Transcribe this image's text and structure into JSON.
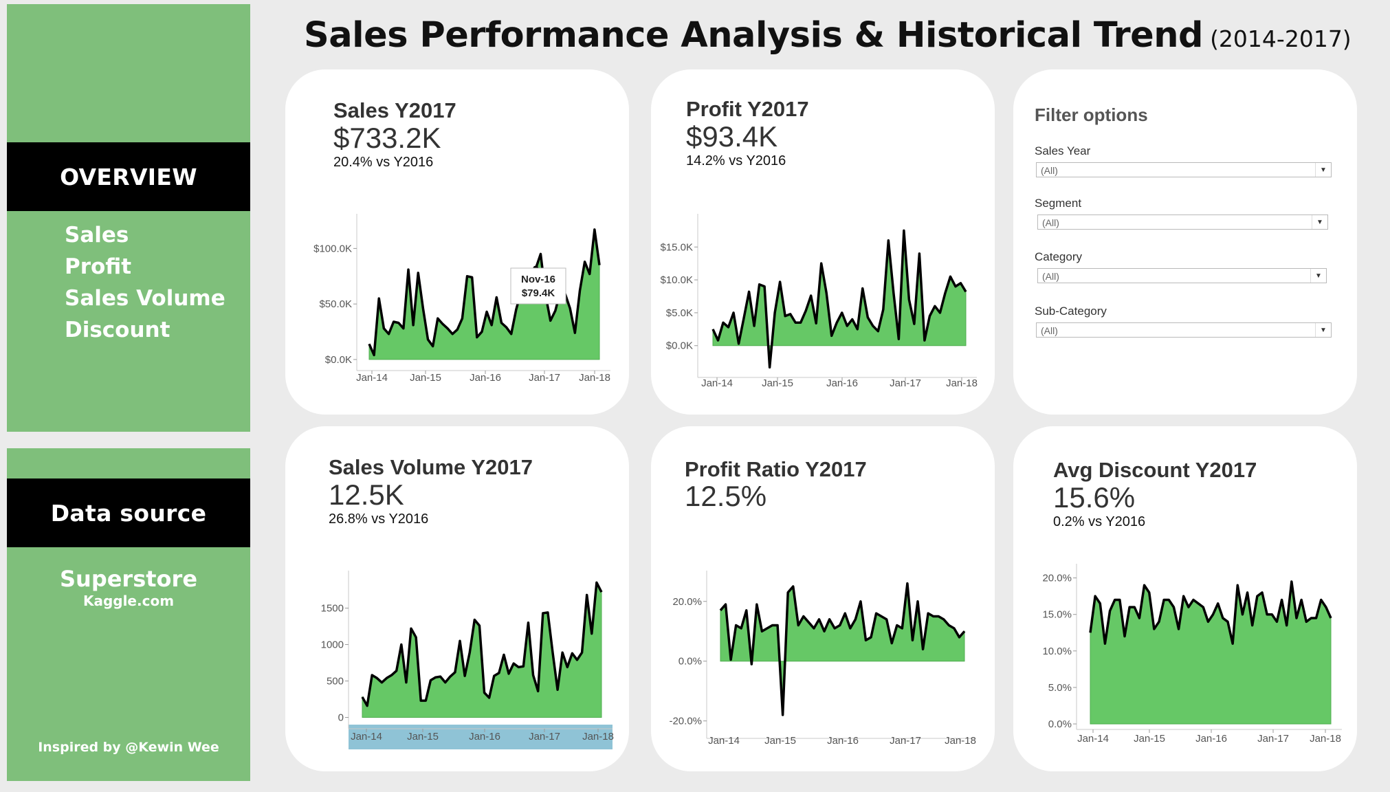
{
  "page": {
    "title": "Sales Performance Analysis & Historical Trend",
    "subtitle": "(2014-2017)"
  },
  "sidebar": {
    "overview_label": "OVERVIEW",
    "nav": [
      "Sales",
      "Profit",
      "Sales Volume",
      "Discount"
    ],
    "datasource_label": "Data source",
    "source_name": "Superstore",
    "source_site": "Kaggle.com",
    "credit": "Inspired by @Kewin Wee"
  },
  "cards": {
    "sales": {
      "title": "Sales Y2017",
      "value": "$733.2K",
      "delta": "20.4% vs Y2016"
    },
    "profit": {
      "title": "Profit Y2017",
      "value": "$93.4K",
      "delta": "14.2% vs Y2016"
    },
    "volume": {
      "title": "Sales Volume Y2017",
      "value": "12.5K",
      "delta": "26.8% vs Y2016"
    },
    "ratio": {
      "title": "Profit Ratio Y2017",
      "value": "12.5%"
    },
    "discount": {
      "title": "Avg Discount Y2017",
      "value": "15.6%",
      "delta": "0.2% vs Y2016"
    }
  },
  "filters": {
    "title": "Filter options",
    "items": [
      {
        "label": "Sales Year",
        "value": "(All)"
      },
      {
        "label": "Segment",
        "value": "(All)"
      },
      {
        "label": "Category",
        "value": "(All)"
      },
      {
        "label": "Sub-Category",
        "value": "(All)"
      }
    ]
  },
  "tooltip": {
    "month": "Nov-16",
    "value": "$79.4K",
    "index": 34
  },
  "colors": {
    "sidebar": "#7fbf7b",
    "area_fill": "#66c866",
    "line": "#000000",
    "axis_highlight": "#8fc3d6"
  },
  "chart_data": [
    {
      "id": "sales",
      "type": "area",
      "x_ticks": [
        "Jan-14",
        "Jan-15",
        "Jan-16",
        "Jan-17",
        "Jan-18"
      ],
      "y_ticks": [
        "$0.0K",
        "$50.0K",
        "$100.0K"
      ],
      "y_tick_values": [
        0,
        50,
        100
      ],
      "ylim": [
        -5,
        125
      ],
      "unit": "K USD",
      "values": [
        14,
        4,
        55,
        28,
        23,
        34,
        33,
        28,
        81,
        31,
        78,
        46,
        18,
        12,
        37,
        32,
        28,
        23,
        27,
        37,
        75,
        74,
        20,
        25,
        43,
        31,
        56,
        33,
        29,
        23,
        45,
        61,
        80,
        68,
        82,
        95,
        58,
        35,
        44,
        61,
        59,
        46,
        24,
        62,
        88,
        77,
        117,
        85
      ]
    },
    {
      "id": "profit",
      "type": "area",
      "x_ticks": [
        "Jan-14",
        "Jan-15",
        "Jan-16",
        "Jan-17",
        "Jan-18"
      ],
      "y_ticks": [
        "$0.0K",
        "$5.0K",
        "$10.0K",
        "$15.0K"
      ],
      "y_tick_values": [
        0,
        5,
        10,
        15
      ],
      "ylim": [
        -4,
        19
      ],
      "unit": "K USD",
      "values": [
        2.5,
        0.8,
        3.5,
        2.8,
        5.0,
        0.3,
        4.2,
        8.2,
        3.0,
        9.3,
        9.0,
        -3.3,
        5.0,
        9.7,
        4.5,
        4.8,
        3.5,
        3.5,
        5.3,
        7.6,
        3.4,
        12.5,
        8.0,
        1.5,
        3.5,
        5.0,
        3.0,
        4.0,
        2.5,
        8.7,
        4.3,
        3.0,
        2.2,
        5.5,
        16.0,
        8.0,
        1.0,
        17.5,
        7.0,
        3.3,
        14.0,
        0.8,
        4.5,
        6.0,
        5.0,
        8.0,
        10.5,
        9.0,
        9.5,
        8.2
      ]
    },
    {
      "id": "volume",
      "type": "area",
      "x_ticks": [
        "Jan-14",
        "Jan-15",
        "Jan-16",
        "Jan-17",
        "Jan-18"
      ],
      "y_ticks": [
        "0",
        "500",
        "1000",
        "1500"
      ],
      "y_tick_values": [
        0,
        500,
        1000,
        1500
      ],
      "ylim": [
        -80,
        1920
      ],
      "unit": "count",
      "values": [
        280,
        160,
        580,
        540,
        480,
        540,
        580,
        640,
        1000,
        480,
        1220,
        1100,
        230,
        230,
        510,
        550,
        560,
        480,
        560,
        620,
        1050,
        570,
        890,
        1340,
        1260,
        340,
        270,
        570,
        610,
        860,
        600,
        740,
        690,
        700,
        1300,
        580,
        360,
        1430,
        1440,
        890,
        380,
        890,
        690,
        880,
        790,
        890,
        1680,
        1150,
        1850,
        1720
      ]
    },
    {
      "id": "ratio",
      "type": "area",
      "x_ticks": [
        "Jan-14",
        "Jan-15",
        "Jan-16",
        "Jan-17",
        "Jan-18"
      ],
      "y_ticks": [
        "-20.0%",
        "0.0%",
        "20.0%"
      ],
      "y_tick_values": [
        -20,
        0,
        20
      ],
      "ylim": [
        -24,
        28
      ],
      "unit": "percent",
      "values": [
        17,
        19,
        0.5,
        12,
        11,
        17,
        -1,
        19,
        10,
        11,
        12,
        12,
        -18,
        23,
        25,
        12,
        15,
        13,
        11,
        14,
        10,
        14,
        11,
        12,
        16,
        11,
        14,
        20,
        7,
        8,
        16,
        15,
        14,
        6,
        12,
        11,
        26,
        7,
        20,
        4,
        16,
        15,
        15,
        14,
        12,
        11,
        8,
        10
      ]
    },
    {
      "id": "discount",
      "type": "area",
      "x_ticks": [
        "Jan-14",
        "Jan-15",
        "Jan-16",
        "Jan-17",
        "Jan-18"
      ],
      "y_ticks": [
        "0.0%",
        "5.0%",
        "10.0%",
        "15.0%",
        "20.0%"
      ],
      "y_tick_values": [
        0,
        5,
        10,
        15,
        20
      ],
      "ylim": [
        0,
        21
      ],
      "unit": "percent",
      "values": [
        12.5,
        17.5,
        16.5,
        11,
        15.5,
        17,
        17,
        12,
        16,
        16,
        14.5,
        19,
        18,
        13,
        14,
        17,
        17,
        16,
        13,
        17.5,
        16,
        17,
        16.5,
        16,
        14,
        15,
        16.5,
        14.5,
        14,
        11,
        19,
        15,
        18,
        13.5,
        17.5,
        18,
        15,
        15,
        14,
        17,
        13.5,
        19.5,
        14.5,
        17,
        14,
        14.5,
        14.5,
        17,
        16,
        14.5
      ]
    }
  ]
}
